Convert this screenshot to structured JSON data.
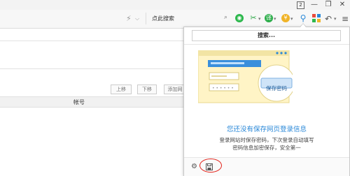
{
  "toolbar": {
    "search_placeholder": "点此搜索",
    "tab_count": "2"
  },
  "page": {
    "buttons": {
      "move_up": "上移",
      "move_down": "下移",
      "add": "添加网"
    },
    "table": {
      "columns": [
        "帐号"
      ]
    }
  },
  "popup": {
    "search_label": "搜索...",
    "illustration": {
      "callout_text": "保存密码"
    },
    "headline": "您还没有保存网页登录信息",
    "description_line1": "登录网站时保存密码，下次登录自动填写",
    "description_line2": "密码信息加密保存，安全第一"
  },
  "colors": {
    "accent_blue": "#2a88d8",
    "highlight_red": "#e2231a",
    "illustration_yellow": "#fff4c6",
    "illustration_blue": "#3a8fdc"
  }
}
